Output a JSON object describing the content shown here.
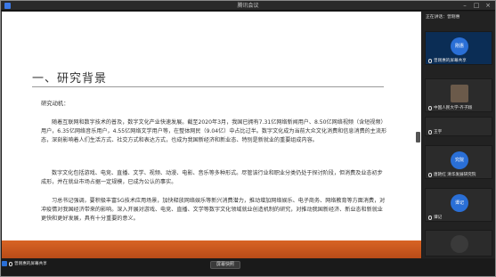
{
  "window": {
    "title": "腾讯会议"
  },
  "slide": {
    "heading": "一、研究背景",
    "lead": "研究动机：",
    "paragraphs": [
      "随着互联网和数字技术的普及，数字文化产业快速发展。截至2020年3月，我国已拥有7.31亿网络新闻用户、8.50亿网络视频（含短视频）用户，6.35亿网络音乐用户，4.55亿网络文学用户等，在整体网民（9.04亿）中占比过半。数字文化成为当前大众文化消费和信息消费的主流形态，深刻影响着人们生活方式、社交方式和表达方式，也成为我国新经济和新业态、特别是新就业的重要组成内容。",
      "数字文化包括游戏、电竞、直播、文学、视频、动漫、电影、音乐等多种形式。尽管该行业和职业分类仍处于探讨阶段，但消费及业态初步成形，并在就业市场占据一定规模，已成为公认的事实。",
      "习总书记强调，要积极丰富5G技术应用场景，加快释放网络娱乐等新兴消费潜力，推动增加网络娱乐、电子商务、网络教育等方面消费，对冲疫情对我国经济带来的影响。深入开展对游戏、电竞、直播、文学等数字文化领域就业创造机制的研究，对推动我国新经济、新业态和新就业更快和更好发展，具有十分重要的意义。"
    ]
  },
  "bottom": {
    "share_status": "曾刚惠的屏幕共享",
    "view_share_button": "屏幕快照"
  },
  "panel": {
    "header": "正在讲话：曾刚惠",
    "participants": [
      {
        "avatar": "刚惠",
        "name": "曾刚惠的屏幕共享",
        "active": true
      },
      {
        "avatar": "",
        "name": "中国人民大学-齐子翔",
        "active": false,
        "camera": true
      },
      {
        "avatar": "",
        "name": "王宇",
        "active": false,
        "small": true
      },
      {
        "avatar": "究院",
        "name": "唐艳红 清华发展研究院",
        "active": false
      },
      {
        "avatar": "谭记",
        "name": "谭记",
        "active": false
      },
      {
        "avatar": "",
        "name": "",
        "active": false
      }
    ]
  },
  "colors": {
    "accent_orange": "#d86424",
    "panel_blue": "#2a6fd6"
  }
}
